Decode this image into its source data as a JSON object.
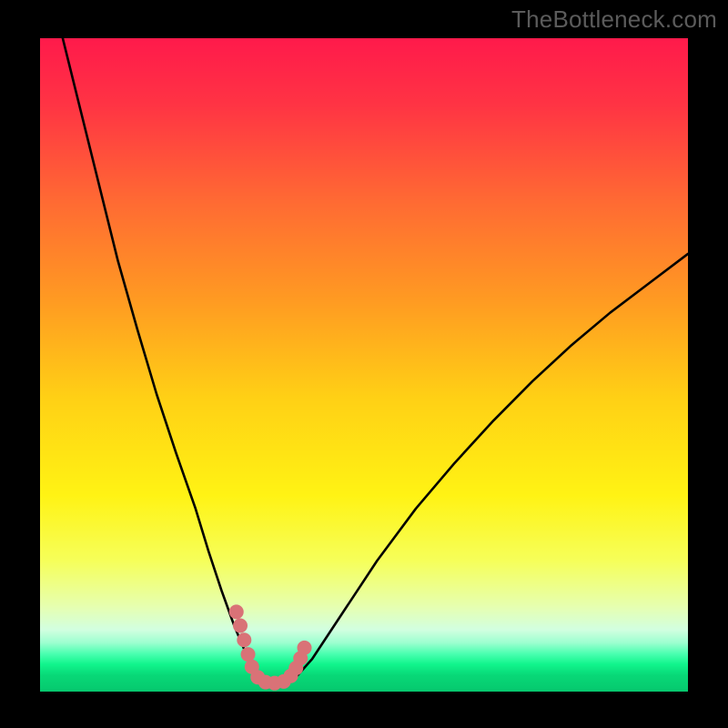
{
  "watermark": "TheBottleneck.com",
  "colors": {
    "curve": "#000000",
    "marker": "#d97277",
    "frame": "#000000"
  },
  "chart_data": {
    "type": "line",
    "title": "",
    "xlabel": "",
    "ylabel": "",
    "xlim": [
      0,
      100
    ],
    "ylim": [
      0,
      100
    ],
    "gradient_bands": [
      {
        "offset": 0.0,
        "color": "#ff1a4b"
      },
      {
        "offset": 0.1,
        "color": "#ff3344"
      },
      {
        "offset": 0.25,
        "color": "#ff6a33"
      },
      {
        "offset": 0.4,
        "color": "#ff9a22"
      },
      {
        "offset": 0.55,
        "color": "#ffd015"
      },
      {
        "offset": 0.7,
        "color": "#fff314"
      },
      {
        "offset": 0.8,
        "color": "#f6ff5a"
      },
      {
        "offset": 0.87,
        "color": "#e6ffb0"
      },
      {
        "offset": 0.905,
        "color": "#d2ffe0"
      },
      {
        "offset": 0.925,
        "color": "#9dffd0"
      },
      {
        "offset": 0.942,
        "color": "#4bffb0"
      },
      {
        "offset": 0.958,
        "color": "#11f58d"
      },
      {
        "offset": 0.975,
        "color": "#08d877"
      },
      {
        "offset": 1.0,
        "color": "#06c86e"
      }
    ],
    "series": [
      {
        "name": "bottleneck_curve",
        "x": [
          3.5,
          6,
          9,
          12,
          15,
          18,
          21,
          24,
          26,
          28,
          30,
          31.5,
          33,
          34,
          35,
          36,
          37.2,
          39.5,
          42,
          46,
          52,
          58,
          64,
          70,
          76,
          82,
          88,
          94,
          100
        ],
        "y": [
          100,
          90,
          78,
          66,
          55.5,
          45.5,
          36.5,
          28,
          21.5,
          15.5,
          10,
          6.5,
          3.5,
          2.0,
          1.3,
          1.2,
          1.3,
          2.2,
          5.0,
          11,
          20,
          28,
          35,
          41.5,
          47.5,
          53,
          58,
          62.5,
          67
        ]
      }
    ],
    "markers": {
      "color": "#d97277",
      "radius_px": 8,
      "points": [
        {
          "x": 30.3,
          "y": 12.2
        },
        {
          "x": 30.9,
          "y": 10.1
        },
        {
          "x": 31.5,
          "y": 7.9
        },
        {
          "x": 32.1,
          "y": 5.7
        },
        {
          "x": 32.7,
          "y": 3.8
        },
        {
          "x": 33.6,
          "y": 2.2
        },
        {
          "x": 34.8,
          "y": 1.45
        },
        {
          "x": 36.2,
          "y": 1.3
        },
        {
          "x": 37.6,
          "y": 1.55
        },
        {
          "x": 38.7,
          "y": 2.4
        },
        {
          "x": 39.5,
          "y": 3.6
        },
        {
          "x": 40.2,
          "y": 5.1
        },
        {
          "x": 40.8,
          "y": 6.7
        }
      ]
    }
  }
}
